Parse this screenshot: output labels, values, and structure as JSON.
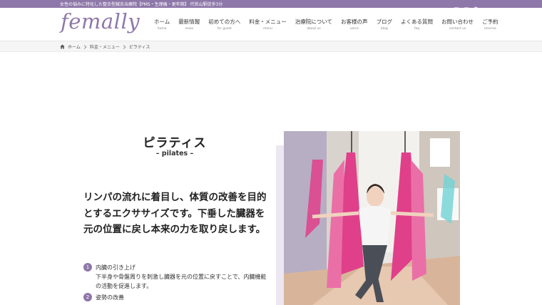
{
  "topbar": {
    "tagline": "女性の悩みに特化した整合型鍼灸治療院【PMS・生理痛・更年期】 代官山駅徒歩3分",
    "icons": [
      "youtube-icon",
      "mail-icon",
      "search-icon"
    ]
  },
  "header": {
    "logo": "femally",
    "nav": [
      {
        "jp": "ホーム",
        "en": "home"
      },
      {
        "jp": "最新情報",
        "en": "news"
      },
      {
        "jp": "初めての方へ",
        "en": "for guest"
      },
      {
        "jp": "料金・メニュー",
        "en": "menu"
      },
      {
        "jp": "治療院について",
        "en": "about us"
      },
      {
        "jp": "お客様の声",
        "en": "voice"
      },
      {
        "jp": "ブログ",
        "en": "blog"
      },
      {
        "jp": "よくある質問",
        "en": "faq"
      },
      {
        "jp": "お問い合わせ",
        "en": "contact us"
      },
      {
        "jp": "ご予約",
        "en": "reserve"
      }
    ]
  },
  "breadcrumb": {
    "items": [
      "ホーム",
      "料金・メニュー",
      "ピラティス"
    ]
  },
  "main": {
    "title": "ピラティス",
    "subtitle": "– pilates –",
    "lead": "リンパの流れに着目し、体質の改善を目的とするエクササイズです。下垂した臓器を元の位置に戻し本来の力を取り戻します。",
    "points": [
      {
        "num": "1",
        "title": "内臓の引き上げ",
        "desc": "下半身や骨盤周りを刺激し臓器を元の位置に戻すことで、内臓機能の活動を促進します。"
      },
      {
        "num": "2",
        "title": "姿勢の改善",
        "desc": ""
      }
    ]
  },
  "colors": {
    "accent": "#8e77a9",
    "hammock": "#e03f8a",
    "panel": "#ece7f1"
  }
}
